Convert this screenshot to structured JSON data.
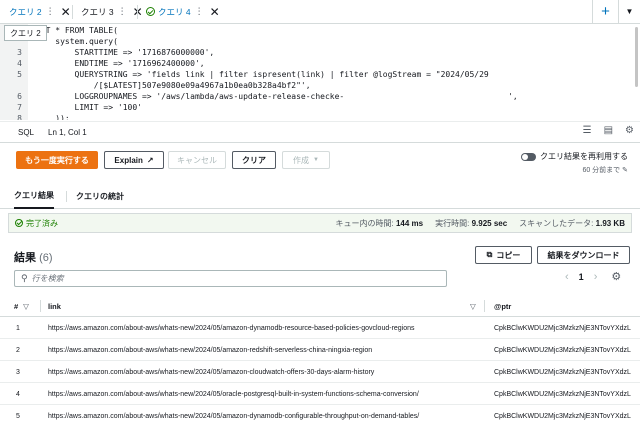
{
  "tabs": [
    {
      "label": "クエリ 2",
      "active": true
    },
    {
      "label": "クエリ 3",
      "active": false
    },
    {
      "label": "クエリ 4",
      "active": false
    }
  ],
  "tab_tooltip": "クエリ 2",
  "editor": {
    "lines": [
      {
        "num": "",
        "text": "ECT * FROM TABLE("
      },
      {
        "num": "",
        "text": "    system.query("
      },
      {
        "num": "3",
        "text": "        STARTTIME => '1716876000000',"
      },
      {
        "num": "4",
        "text": "        ENDTIME => '1716962400000',"
      },
      {
        "num": "5",
        "text": "        QUERYSTRING => 'fields link | filter ispresent(link) | filter @logStream = \"2024/05/29"
      },
      {
        "num": "",
        "text": "            /[$LATEST]507e9080e09a4967a1b0ea0b328a4bf2\"',"
      },
      {
        "num": "6",
        "text": "        LOGGROUPNAMES => '/aws/lambda/aws-update-release-checke-                                  ',"
      },
      {
        "num": "7",
        "text": "        LIMIT => '100'"
      },
      {
        "num": "8",
        "text": "    ));"
      }
    ]
  },
  "statusbar": {
    "lang": "SQL",
    "position": "Ln 1, Col 1"
  },
  "toolbar": {
    "rerun": "もう一度実行する",
    "explain": "Explain",
    "cancel": "キャンセル",
    "clear": "クリア",
    "create": "作成",
    "reuse_label": "クエリ結果を再利用する",
    "reuse_sub": "60 分前まで"
  },
  "result_tabs": {
    "results": "クエリ結果",
    "stats": "クエリの統計"
  },
  "status": {
    "state": "完了済み",
    "queue_label": "キュー内の時間:",
    "queue_value": "144 ms",
    "exec_label": "実行時間:",
    "exec_value": "9.925 sec",
    "scan_label": "スキャンしたデータ:",
    "scan_value": "1.93 KB"
  },
  "results": {
    "title": "結果",
    "count": "(6)",
    "copy": "コピー",
    "download": "結果をダウンロード",
    "search_placeholder": "行を検索",
    "page": "1"
  },
  "table": {
    "headers": {
      "num": "#",
      "link": "link",
      "ptr": "@ptr"
    },
    "rows": [
      {
        "num": "1",
        "link": "https://aws.amazon.com/about-aws/whats-new/2024/05/amazon-dynamodb-resource-based-policies-govcloud-regions",
        "ptr": "CpkBClwKWDU2Mjc3MzkzNjE3NTovYXdzL"
      },
      {
        "num": "2",
        "link": "https://aws.amazon.com/about-aws/whats-new/2024/05/amazon-redshift-serverless-china-ningxia-region",
        "ptr": "CpkBClwKWDU2Mjc3MzkzNjE3NTovYXdzL"
      },
      {
        "num": "3",
        "link": "https://aws.amazon.com/about-aws/whats-new/2024/05/amazon-cloudwatch-offers-30-days-alarm-history",
        "ptr": "CpkBClwKWDU2Mjc3MzkzNjE3NTovYXdzL"
      },
      {
        "num": "4",
        "link": "https://aws.amazon.com/about-aws/whats-new/2024/05/oracle-postgresql-built-in-system-functions-schema-conversion/",
        "ptr": "CpkBClwKWDU2Mjc3MzkzNjE3NTovYXdzL"
      },
      {
        "num": "5",
        "link": "https://aws.amazon.com/about-aws/whats-new/2024/05/amazon-dynamodb-configurable-throughput-on-demand-tables/",
        "ptr": "CpkBClwKWDU2Mjc3MzkzNjE3NTovYXdzL"
      }
    ]
  },
  "colors": {
    "accent": "#0073bb",
    "primary_button": "#ec7211",
    "success": "#1d8102"
  }
}
